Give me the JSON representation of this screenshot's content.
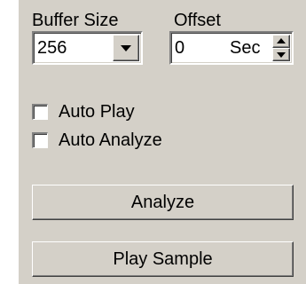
{
  "buffer_size": {
    "label": "Buffer Size",
    "selected_value": "256"
  },
  "offset": {
    "label": "Offset",
    "value": "0",
    "unit": "Sec"
  },
  "checkboxes": [
    {
      "label": "Auto Play",
      "checked": false
    },
    {
      "label": "Auto Analyze",
      "checked": false
    }
  ],
  "buttons": {
    "analyze": "Analyze",
    "play_sample": "Play Sample"
  },
  "colors": {
    "panel_bg": "#d4d0c8",
    "field_bg": "#ffffff"
  }
}
